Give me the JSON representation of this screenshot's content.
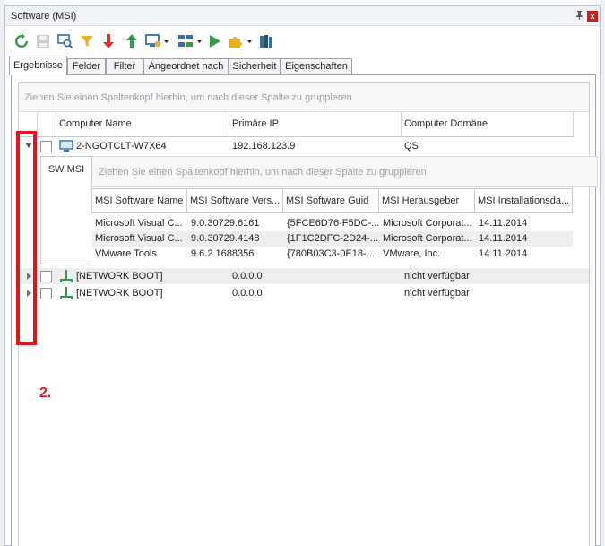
{
  "window": {
    "title": "Software (MSI)",
    "pin_icon": "pin-icon",
    "close_glyph": "x"
  },
  "toolbar": {
    "icons": [
      "refresh-icon",
      "save-icon",
      "find-icon",
      "filter-icon",
      "arrow-down-icon",
      "arrow-up-icon",
      "computer-settings-icon",
      "network-icon",
      "run-icon",
      "puzzle-icon",
      "books-icon"
    ]
  },
  "tabs": [
    "Ergebnisse",
    "Felder",
    "Filter",
    "Angeordnet nach",
    "Sicherheit",
    "Eigenschaften"
  ],
  "grid": {
    "group_hint": "Ziehen Sie einen Spaltenkopf hierhin, um nach dieser Spalte zu gruppieren",
    "columns": [
      "Computer Name",
      "Primäre IP",
      "Computer Domäne"
    ],
    "rows": [
      {
        "name": "2-NGOTCLT-W7X64",
        "ip": "192.168.123.9",
        "domain": "QS"
      },
      {
        "name": "[NETWORK BOOT]",
        "ip": "0.0.0.0",
        "domain": "nicht verfügbar"
      },
      {
        "name": "[NETWORK BOOT]",
        "ip": "0.0.0.0",
        "domain": "nicht verfügbar"
      }
    ]
  },
  "detail": {
    "tab": "SW MSI",
    "group_hint": "Ziehen Sie einen Spaltenkopf hierhin, um nach dieser Spalte zu gruppieren",
    "columns": [
      "MSI Software Name",
      "MSI Software Vers...",
      "MSI Software Guid",
      "MSI Herausgeber",
      "MSI Installationsda..."
    ],
    "rows": [
      [
        "Microsoft Visual C...",
        "9.0.30729.6161",
        "{5FCE6D76-F5DC-...",
        "Microsoft Corporat...",
        "14.11.2014"
      ],
      [
        "Microsoft Visual C...",
        "9.0.30729.4148",
        "{1F1C2DFC-2D24-...",
        "Microsoft Corporat...",
        "14.11.2014"
      ],
      [
        "VMware Tools",
        "9.6.2.1688356",
        "{780B03C3-0E18-...",
        "VMware, Inc.",
        "14.11.2014"
      ]
    ]
  },
  "annotation": {
    "label": "2.",
    "color": "#e2151c"
  },
  "colors": {
    "accent_green": "#2e9e4a",
    "accent_red": "#d33a2c",
    "accent_blue": "#2f6fb3"
  }
}
